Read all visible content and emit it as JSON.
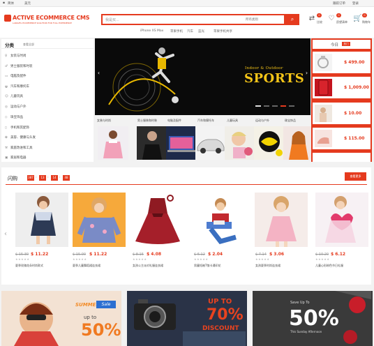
{
  "topbar": {
    "language": "简体",
    "currency": "美元",
    "links": [
      "跟踪订单",
      "登录"
    ]
  },
  "logo": {
    "title": "ACTIVE ECOMMERCE CMS",
    "subtitle": "LARAVEL ECOMMERCE SOLUTION FOR FULL EXPERIENCE"
  },
  "search": {
    "placeholder": "我是买...",
    "category": "所有类别"
  },
  "hot_searches": [
    "iPhone XS Max",
    "苹果手机",
    "汽车",
    "蓝光",
    "苹果手机共享"
  ],
  "header_icons": [
    {
      "label": "比较",
      "count": "0"
    },
    {
      "label": "愿望清单",
      "count": "0"
    },
    {
      "label": "购物车",
      "count": "0"
    }
  ],
  "categories": {
    "title": "分类",
    "see_all": "查看全部",
    "items": [
      "女装与时尚",
      "男士服装和时装",
      "电脑及配件",
      "汽车和摩托车",
      "儿童玩具",
      "运动与户外",
      "珠宝饰品",
      "手机和其配饰",
      "美容、健康与头发",
      "家庭改进和工具",
      "家居和电器"
    ]
  },
  "banner": {
    "line1": "Indoor & Outdoor",
    "line2": "SPORTS"
  },
  "subcategories": [
    "女装与时尚",
    "男士服装和时装",
    "电脑及配件",
    "汽车和摩托车",
    "儿童玩具",
    "运动与户外",
    "珠宝饰品"
  ],
  "today": {
    "title": "今日",
    "badge": "热门",
    "prices": [
      "$ 499.00",
      "$ 1,009.00",
      "$ 10.00",
      "$ 115.00"
    ]
  },
  "flash_sale": {
    "title": "闪购",
    "countdown": [
      "387",
      "13",
      "14",
      "48"
    ],
    "more_label": "查看更多",
    "products": [
      {
        "old": "$ 15.30",
        "new": "$ 11.22",
        "name": "夏季玫瑰花朵时尚款式"
      },
      {
        "old": "$ 15.00",
        "new": "$ 11.22",
        "name": "夏季儿童舞蹈裙连衣裙"
      },
      {
        "old": "$ 8.15",
        "new": "$ 4.08",
        "name": "女孩公主派对礼服连衣裙"
      },
      {
        "old": "$ 6.12",
        "new": "$ 2.04",
        "name": "男童短袖T恤卡通印花"
      },
      {
        "old": "$ 7.14",
        "new": "$ 3.06",
        "name": "女孩夏季时尚连衣裙"
      },
      {
        "old": "$ 10.20",
        "new": "$ 6.12",
        "name": "儿童心形粉色节日礼服"
      }
    ]
  },
  "promos": {
    "p1": {
      "summer": "SUMMER",
      "sale": "Sale",
      "upto": "up to",
      "pct": "50%"
    },
    "p2": {
      "upto": "UP TO",
      "pct": "70%",
      "discount": "DISCOUNT"
    },
    "p3": {
      "save": "Save Up To",
      "pct": "50%",
      "sub": "This Sunday Afternoon"
    }
  },
  "colors": {
    "accent": "#e53a1e"
  }
}
